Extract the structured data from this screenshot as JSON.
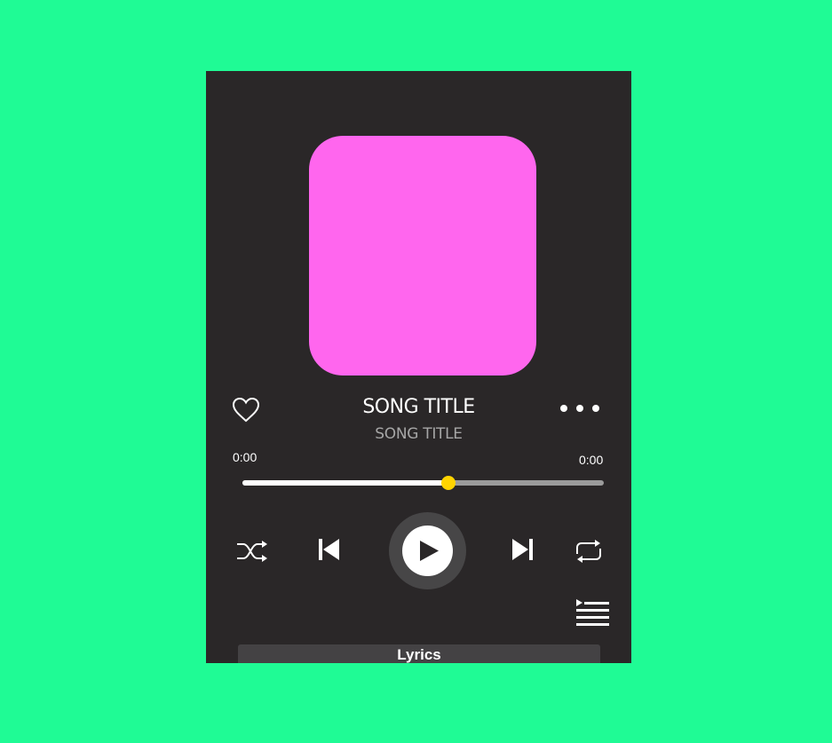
{
  "colors": {
    "background": "#1ffb95",
    "player_bg": "#2a2728",
    "artwork": "#ff66ee",
    "progress_thumb": "#ffd400"
  },
  "song": {
    "title": "SONG TITLE",
    "artist": "SONG TITLE"
  },
  "progress": {
    "elapsed": "0:00",
    "total": "0:00",
    "fraction": 0.57
  },
  "icons": {
    "like": "heart-icon",
    "more": "more-dots-icon",
    "shuffle": "shuffle-icon",
    "previous": "skip-previous-icon",
    "play": "play-icon",
    "next": "skip-next-icon",
    "repeat": "repeat-icon",
    "queue": "queue-list-icon"
  },
  "lyrics": {
    "label": "Lyrics"
  }
}
